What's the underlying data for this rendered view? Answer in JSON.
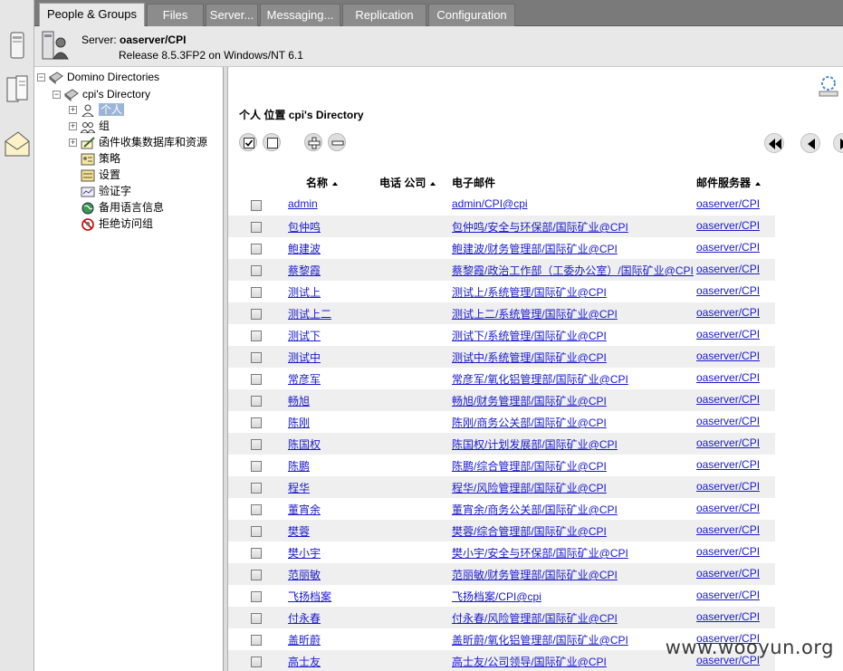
{
  "tabs": [
    {
      "label": "People & Groups",
      "active": true
    },
    {
      "label": "Files",
      "active": false
    },
    {
      "label": "Server...",
      "active": false
    },
    {
      "label": "Messaging...",
      "active": false
    },
    {
      "label": "Replication",
      "active": false
    },
    {
      "label": "Configuration",
      "active": false
    }
  ],
  "server": {
    "label": "Server:",
    "name": "oaserver/CPI",
    "release": "Release 8.5.3FP2 on Windows/NT 6.1"
  },
  "tree": {
    "root": "Domino Directories",
    "directory": "cpi's Directory",
    "items": [
      {
        "label": "个人",
        "icon": "person-icon",
        "expandable": true,
        "selected": true
      },
      {
        "label": "组",
        "icon": "group-icon",
        "expandable": true,
        "selected": false
      },
      {
        "label": "函件收集数据库和资源",
        "icon": "mail-in-icon",
        "expandable": true,
        "selected": false
      },
      {
        "label": "策略",
        "icon": "policy-icon",
        "expandable": false,
        "selected": false
      },
      {
        "label": "设置",
        "icon": "settings-icon",
        "expandable": false,
        "selected": false
      },
      {
        "label": "验证字",
        "icon": "certifier-icon",
        "expandable": false,
        "selected": false
      },
      {
        "label": "备用语言信息",
        "icon": "globe-icon",
        "expandable": false,
        "selected": false
      },
      {
        "label": "拒绝访问组",
        "icon": "deny-icon",
        "expandable": false,
        "selected": false
      }
    ]
  },
  "view": {
    "prefix": "个人  位置",
    "location": "cpi's Directory"
  },
  "columns": {
    "name": "名称",
    "phone_company": "电话 公司",
    "email": "电子邮件",
    "mail_server": "邮件服务器"
  },
  "rows": [
    {
      "name": "admin",
      "email": "admin/CPI@cpi",
      "server": "oaserver/CPI"
    },
    {
      "name": "包仲鸣",
      "email": "包仲鸣/安全与环保部/国际矿业@CPI",
      "server": "oaserver/CPI"
    },
    {
      "name": "鲍建波",
      "email": "鲍建波/财务管理部/国际矿业@CPI",
      "server": "oaserver/CPI"
    },
    {
      "name": "蔡黎霞",
      "email": "蔡黎霞/政治工作部（工委办公室）/国际矿业@CPI",
      "server": "oaserver/CPI"
    },
    {
      "name": "测试上",
      "email": "测试上/系统管理/国际矿业@CPI",
      "server": "oaserver/CPI"
    },
    {
      "name": "测试上二",
      "email": "测试上二/系统管理/国际矿业@CPI",
      "server": "oaserver/CPI"
    },
    {
      "name": "测试下",
      "email": "测试下/系统管理/国际矿业@CPI",
      "server": "oaserver/CPI"
    },
    {
      "name": "测试中",
      "email": "测试中/系统管理/国际矿业@CPI",
      "server": "oaserver/CPI"
    },
    {
      "name": "常彦军",
      "email": "常彦军/氧化铝管理部/国际矿业@CPI",
      "server": "oaserver/CPI"
    },
    {
      "name": "畅旭",
      "email": "畅旭/财务管理部/国际矿业@CPI",
      "server": "oaserver/CPI"
    },
    {
      "name": "陈刚",
      "email": "陈刚/商务公关部/国际矿业@CPI",
      "server": "oaserver/CPI"
    },
    {
      "name": "陈国权",
      "email": "陈国权/计划发展部/国际矿业@CPI",
      "server": "oaserver/CPI"
    },
    {
      "name": "陈鹏",
      "email": "陈鹏/综合管理部/国际矿业@CPI",
      "server": "oaserver/CPI"
    },
    {
      "name": "程华",
      "email": "程华/风险管理部/国际矿业@CPI",
      "server": "oaserver/CPI"
    },
    {
      "name": "董宵余",
      "email": "董宵余/商务公关部/国际矿业@CPI",
      "server": "oaserver/CPI"
    },
    {
      "name": "樊蓉",
      "email": "樊蓉/综合管理部/国际矿业@CPI",
      "server": "oaserver/CPI"
    },
    {
      "name": "樊小宇",
      "email": "樊小宇/安全与环保部/国际矿业@CPI",
      "server": "oaserver/CPI"
    },
    {
      "name": "范丽敏",
      "email": "范丽敏/财务管理部/国际矿业@CPI",
      "server": "oaserver/CPI"
    },
    {
      "name": "飞扬档案",
      "email": "飞扬档案/CPI@cpi",
      "server": "oaserver/CPI"
    },
    {
      "name": "付永春",
      "email": "付永春/风险管理部/国际矿业@CPI",
      "server": "oaserver/CPI"
    },
    {
      "name": "盖昕蔚",
      "email": "盖昕蔚/氧化铝管理部/国际矿业@CPI",
      "server": "oaserver/CPI"
    },
    {
      "name": "高士友",
      "email": "高士友/公司领导/国际矿业@CPI",
      "server": "oaserver/CPI"
    }
  ],
  "watermark": "www.wooyun.org"
}
